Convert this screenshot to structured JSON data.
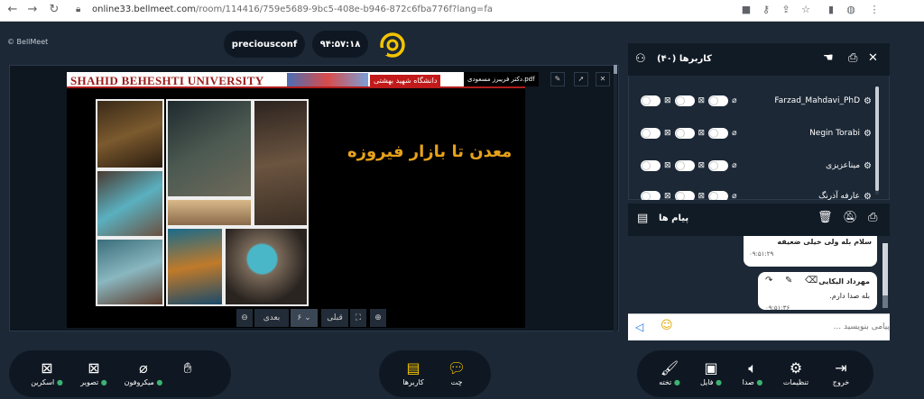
{
  "browser": {
    "url_host": "online33.bellmeet.com",
    "url_path": "/room/114416/759e5689-9bc5-408e-b946-872c6fba776f?lang=fa"
  },
  "app": {
    "logo": "© BellMeet",
    "room_name": "preciousconf",
    "timer": "۹۴:۵۷:۱۸"
  },
  "presentation": {
    "file_name": "دکتر فریبرز مسعودی.pdf",
    "banner_left": "SHAHID BEHESHTI UNIVERSITY",
    "banner_right": "دانشگاه شهید بهشتی",
    "slide_title": "معدن تا بازار فیروزه",
    "controls": {
      "prev": "قبلی",
      "next": "بعدی",
      "page": "۶"
    }
  },
  "users_panel": {
    "title": "کاربرها (۴۰)",
    "users": [
      {
        "name": "Farzad_Mahdavi_PhD"
      },
      {
        "name": "Negin Torabi"
      },
      {
        "name": "میناعزیزی"
      },
      {
        "name": "عارفه آذرنگ"
      }
    ]
  },
  "messages_panel": {
    "title": "پیام ها",
    "messages": [
      {
        "text": "سلام بله ولی خیلی ضعیفه",
        "time": "۰۹:۵۱:۲۹"
      },
      {
        "author": "مهرداد الیکایی",
        "text": "بله صدا دارم.",
        "time": "۰۹:۵۱:۳۶"
      }
    ],
    "input_placeholder": "پیامی بنویسید ..."
  },
  "bottom_left": {
    "screen": "اسکرین",
    "camera": "تصویر",
    "mic": "میکروفون"
  },
  "bottom_center": {
    "chat": "چت",
    "users": "کاربرها"
  },
  "bottom_right": {
    "board": "تخته",
    "file": "فایل",
    "sound": "صدا",
    "settings": "تنظیمات",
    "exit": "خروج"
  },
  "colors": {
    "accent": "#f5c400",
    "background": "#1c2836",
    "panel": "#0f1822",
    "status_dot": "#3cb371"
  }
}
